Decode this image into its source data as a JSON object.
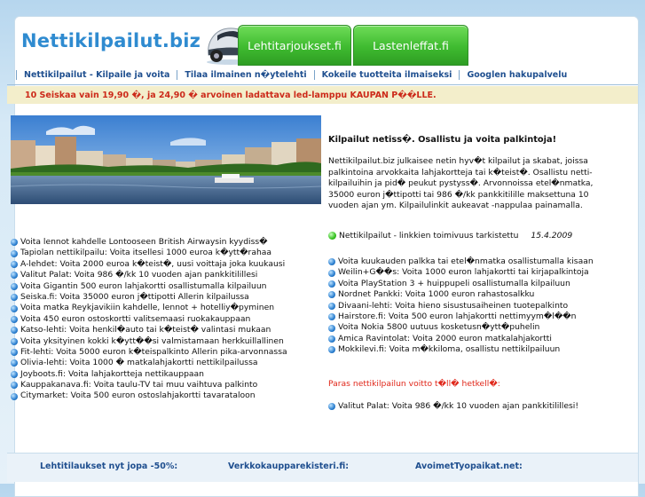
{
  "site": {
    "logo": "Nettikilpailut.biz",
    "tabs": [
      "Lehtitarjoukset.fi",
      "Lastenleffat.fi"
    ]
  },
  "nav": {
    "items": [
      "Nettikilpailut - Kilpaile ja voita",
      "Tilaa ilmainen n�ytelehti",
      "Kokeile tuotteita ilmaiseksi",
      "Googlen hakupalvelu"
    ]
  },
  "promo": {
    "text": "10 Seiskaa vain 19,90 �, ja 24,90 � arvoinen ladattava led-lamppu KAUPAN P��LLE."
  },
  "intro": {
    "heading": "Kilpailut netiss�. Osallistu ja voita palkintoja!",
    "description": "Nettikilpailut.biz julkaisee netin hyv�t kilpailut ja skabat, joissa palkintoina arvokkaita lahjakortteja tai k�teist�. Osallistu netti-kilpailuihin ja pid� peukut pystyss�. Arvonnoissa etel�nmatka, 35000 euron j�ttipotti tai 986 �/kk pankkitilille maksettuna 10 vuoden ajan ym. Kilpailulinkit aukeavat -nappulaa painamalla."
  },
  "status": {
    "text": "Nettikilpailut - linkkien toimivuus tarkistettu",
    "date": "15.4.2009"
  },
  "left_list": [
    "Voita lennot kahdelle Lontooseen British Airwaysin kyydiss�",
    "Tapiolan nettikilpailu: Voita itsellesi 1000 euroa k�ytt�rahaa",
    "A-lehdet: Voita 2000 euroa k�teist�, uusi voittaja joka kuukausi",
    "Valitut Palat: Voita 986 �/kk 10 vuoden ajan pankkitilillesi",
    "Voita Gigantin 500 euron lahjakortti osallistumalla kilpailuun",
    "Seiska.fi: Voita 35000 euron j�ttipotti Allerin kilpailussa",
    "Voita matka Reykjavikiin kahdelle, lennot + hotelliy�pyminen",
    "Voita 450 euron ostoskortti valitsemaasi ruokakauppaan",
    "Katso-lehti: Voita henkil�auto tai k�teist� valintasi mukaan",
    "Voita yksityinen kokki k�ytt��si valmistamaan herkkuillallinen",
    "Fit-lehti: Voita 5000 euron k�teispalkinto Allerin pika-arvonnassa",
    "Olivia-lehti: Voita 1000 � matkalahjakortti nettikilpailussa",
    "Joyboots.fi: Voita lahjakortteja nettikauppaan",
    "Kauppakanava.fi: Voita taulu-TV tai muu vaihtuva palkinto",
    "Citymarket: Voita 500 euron ostoslahjakortti tavarataloon"
  ],
  "right_list": [
    "Voita kuukauden palkka tai etel�nmatka osallistumalla kisaan",
    "Weilin+G��s: Voita 1000 euron lahjakortti tai kirjapalkintoja",
    "Voita PlayStation 3 + huippupeli osallistumalla kilpailuun",
    "Nordnet Pankki: Voita 1000 euron rahastosalkku",
    "Divaani-lehti: Voita hieno sisustusaiheinen tuotepalkinto",
    "Hairstore.fi: Voita 500 euron lahjakortti nettimyym�l��n",
    "Voita Nokia 5800 uutuus kosketusn�ytt�puhelin",
    "Amica Ravintolat: Voita 2000 euron matkalahjakortti",
    "Mokkilevi.fi: Voita m�kkiloma, osallistu nettikilpailuun"
  ],
  "best": {
    "heading": "Paras nettikilpailun voitto t�ll� hetkell�:",
    "item": "Valitut Palat: Voita 986 �/kk 10 vuoden ajan pankkitilillesi!"
  },
  "footer": {
    "links": [
      "Lehtitilaukset nyt jopa -50%:",
      "Verkkokaupparekisteri.fi:",
      "AvoimetTyopaikat.net:"
    ]
  },
  "colors": {
    "logo": "#2f8bd0",
    "tab_green": "#3fbb30",
    "nav_text": "#1f4f8f",
    "promo_bg": "#f3eecb",
    "promo_text": "#cc2a1a",
    "best_heading": "#e0271a",
    "bullet": "#2b7fd0",
    "status_dot": "#35c11f"
  },
  "icons": {
    "logo_image": "smart-car-icon",
    "list_bullet": "blue-bullet-icon",
    "status_dot": "green-dot-icon"
  }
}
